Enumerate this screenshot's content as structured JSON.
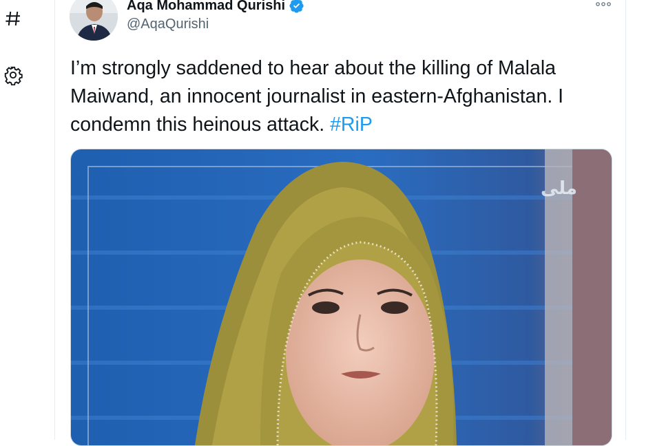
{
  "nav": {
    "icons": [
      "hashtag-icon",
      "gear-icon"
    ]
  },
  "tweet": {
    "display_name": "Aqa Mohammad Qurishi",
    "handle": "@AqaQurishi",
    "verified": true,
    "text_main": "I’m strongly saddened to hear about the killing of Malala Maiwand, an innocent journalist in eastern-Afghanistan. I condemn this heinous attack. ",
    "hashtag": "#RiP",
    "media": {
      "description": "",
      "watermark": "ملی"
    }
  },
  "colors": {
    "link": "#1d9bf0",
    "verified": "#1d9bf0",
    "secondary_text": "#536471",
    "border": "#e6ecf0"
  }
}
